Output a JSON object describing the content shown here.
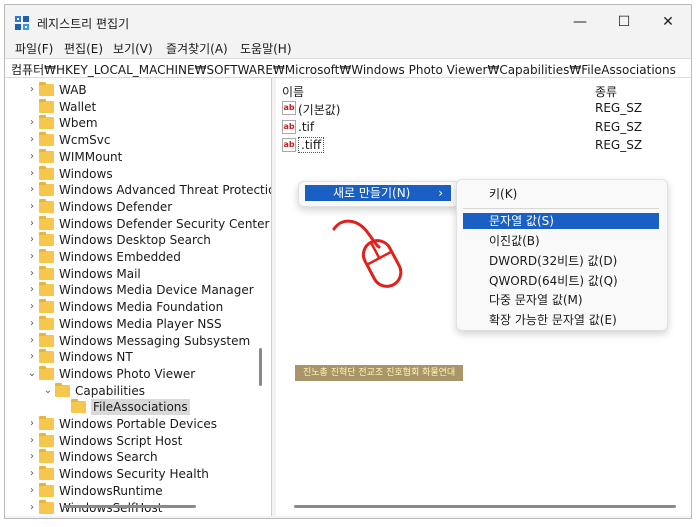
{
  "window": {
    "title": "레지스트리 편집기",
    "minimize": "—",
    "maximize": "☐",
    "close": "✕"
  },
  "menu": [
    "파일(F)",
    "편집(E)",
    "보기(V)",
    "즐겨찾기(A)",
    "도움말(H)"
  ],
  "address": "컴퓨터₩HKEY_LOCAL_MACHINE₩SOFTWARE₩Microsoft₩Windows Photo Viewer₩Capabilities₩FileAssociations",
  "tree": [
    {
      "label": "WAB",
      "expander": "›",
      "depth": 0
    },
    {
      "label": "Wallet",
      "expander": "",
      "depth": 0
    },
    {
      "label": "Wbem",
      "expander": "›",
      "depth": 0
    },
    {
      "label": "WcmSvc",
      "expander": "›",
      "depth": 0
    },
    {
      "label": "WIMMount",
      "expander": "›",
      "depth": 0
    },
    {
      "label": "Windows",
      "expander": "›",
      "depth": 0
    },
    {
      "label": "Windows Advanced Threat Protection",
      "expander": "›",
      "depth": 0
    },
    {
      "label": "Windows Defender",
      "expander": "›",
      "depth": 0
    },
    {
      "label": "Windows Defender Security Center",
      "expander": "›",
      "depth": 0
    },
    {
      "label": "Windows Desktop Search",
      "expander": "›",
      "depth": 0
    },
    {
      "label": "Windows Embedded",
      "expander": "›",
      "depth": 0
    },
    {
      "label": "Windows Mail",
      "expander": "›",
      "depth": 0
    },
    {
      "label": "Windows Media Device Manager",
      "expander": "›",
      "depth": 0
    },
    {
      "label": "Windows Media Foundation",
      "expander": "›",
      "depth": 0
    },
    {
      "label": "Windows Media Player NSS",
      "expander": "›",
      "depth": 0
    },
    {
      "label": "Windows Messaging Subsystem",
      "expander": "›",
      "depth": 0
    },
    {
      "label": "Windows NT",
      "expander": "›",
      "depth": 0
    },
    {
      "label": "Windows Photo Viewer",
      "expander": "⌄",
      "depth": 0
    },
    {
      "label": "Capabilities",
      "expander": "⌄",
      "depth": 1
    },
    {
      "label": "FileAssociations",
      "expander": "",
      "depth": 2,
      "selected": true
    },
    {
      "label": "Windows Portable Devices",
      "expander": "›",
      "depth": 0
    },
    {
      "label": "Windows Script Host",
      "expander": "›",
      "depth": 0
    },
    {
      "label": "Windows Search",
      "expander": "›",
      "depth": 0
    },
    {
      "label": "Windows Security Health",
      "expander": "›",
      "depth": 0
    },
    {
      "label": "WindowsRuntime",
      "expander": "›",
      "depth": 0
    },
    {
      "label": "WindowsSelfHost",
      "expander": "›",
      "depth": 0
    }
  ],
  "values_header": {
    "name": "이름",
    "type": "종류"
  },
  "values": [
    {
      "name": "(기본값)",
      "type": "REG_SZ"
    },
    {
      "name": ".tif",
      "type": "REG_SZ"
    },
    {
      "name": ".tiff",
      "type": "REG_SZ"
    }
  ],
  "context_menu": {
    "new_item": "새로 만들기(N)",
    "arrow": "›"
  },
  "submenu": {
    "items": [
      "키(K)",
      "문자열 값(S)",
      "이진값(B)",
      "DWORD(32비트) 값(D)",
      "QWORD(64비트) 값(Q)",
      "다중 문자열 값(M)",
      "확장 가능한 문자열 값(E)"
    ],
    "highlighted_index": 1
  },
  "watermark": "진노총 진혁단 전교조 진호협회 화물연대",
  "colors": {
    "highlight": "#1a5fc4",
    "folder": "#f7c64d",
    "annotation": "#e0201a"
  }
}
